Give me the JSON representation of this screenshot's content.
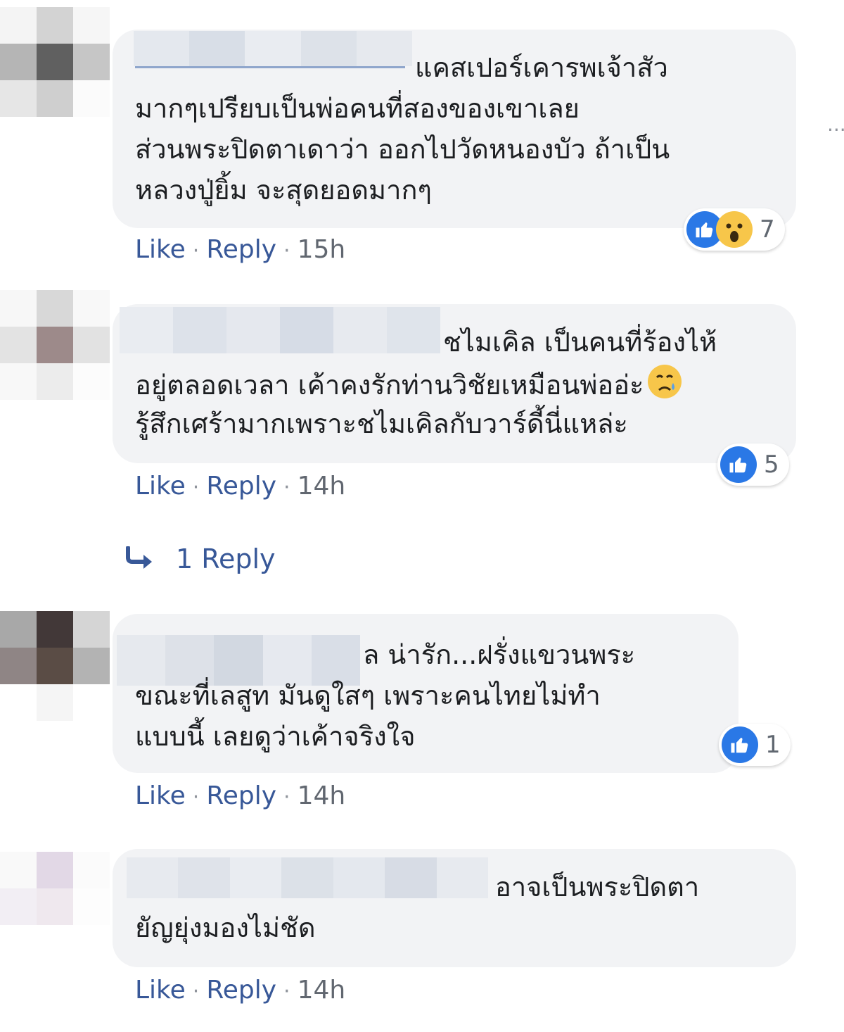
{
  "actions": {
    "like": "Like",
    "reply": "Reply",
    "sep": "·"
  },
  "more_menu": "···",
  "comments": [
    {
      "lines": [
        "แคสเปอร์เคารพเจ้าสัว",
        "มากๆเปรียบเป็นพ่อคนที่สองของเขาเลย",
        "ส่วนพระปิดตาเดาว่า ออกไปวัดหนองบัว ถ้าเป็น",
        "หลวงปู่ยิ้ม จะสุดยอดมากๆ"
      ],
      "time": "15h",
      "reactions": {
        "icons": [
          "like-icon",
          "wow-icon"
        ],
        "count": "7"
      }
    },
    {
      "lines": [
        "ชไมเคิล เป็นคนที่ร้องไห้",
        "อยู่ตลอดเวลา เค้าคงรักท่านวิชัยเหมือนพ่ออ่ะ",
        "รู้สึกเศร้ามากเพราะชไมเคิลกับวาร์ดี้นี่แหล่ะ"
      ],
      "emoji": "sad-face-icon",
      "time": "14h",
      "reactions": {
        "icons": [
          "like-icon"
        ],
        "count": "5"
      },
      "replies_link": "1 Reply"
    },
    {
      "lines": [
        "ล น่ารัก...ฝรั่งแขวนพระ",
        "ขณะที่เลสูท มันดูใสๆ เพราะคนไทยไม่ทำ",
        "แบบนี้ เลยดูว่าเค้าจริงใจ"
      ],
      "time": "14h",
      "reactions": {
        "icons": [
          "like-icon"
        ],
        "count": "1"
      }
    },
    {
      "lines": [
        "อาจเป็นพระปิดตา",
        "ยัญยุ่งมองไม่ชัด"
      ],
      "time": "14h"
    }
  ],
  "colors": {
    "link": "#385898",
    "bubble": "#f2f3f5",
    "like": "#2a78e6"
  }
}
